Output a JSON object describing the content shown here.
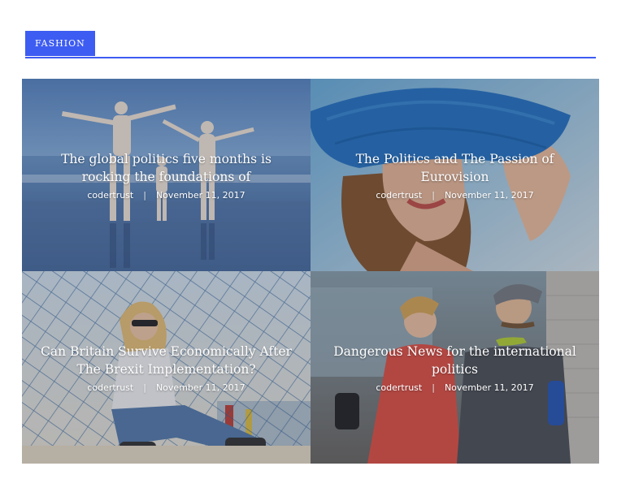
{
  "section": {
    "label": "FASHION"
  },
  "posts": [
    {
      "title": "The global politics five months is rocking the foundations of",
      "author": "codertrust",
      "date": "November 11, 2017"
    },
    {
      "title": "The Politics and The Passion of Eurovision",
      "author": "codertrust",
      "date": "November 11, 2017"
    },
    {
      "title": "Can Britain Survive Economically After The Brexit Implementation?",
      "author": "codertrust",
      "date": "November 11, 2017"
    },
    {
      "title": "Dangerous News for the international politics",
      "author": "codertrust",
      "date": "November 11, 2017"
    }
  ],
  "meta_separator": "|",
  "colors": {
    "accent": "#3d5cf2"
  }
}
